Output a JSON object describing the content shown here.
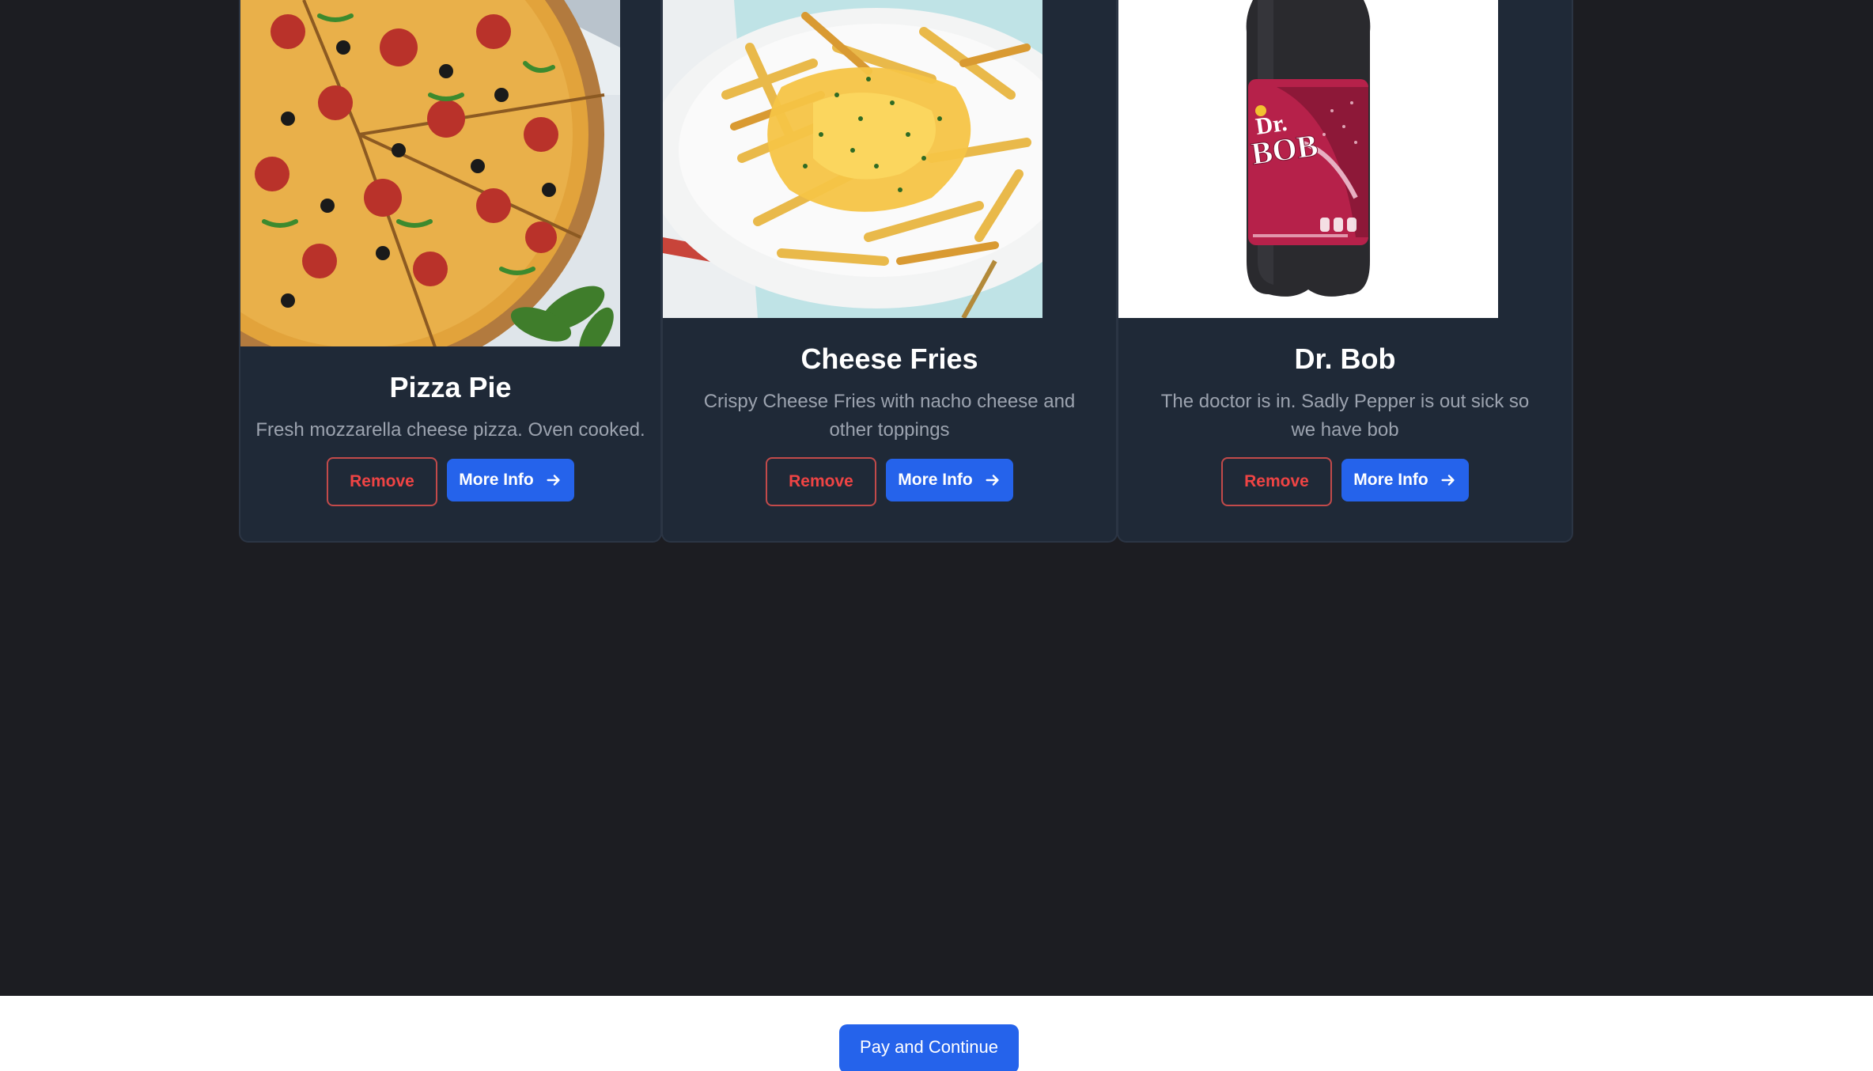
{
  "products": [
    {
      "title": "Pizza Pie",
      "description": "Fresh mozzarella cheese pizza. Oven cooked.",
      "image": "pizza-photo",
      "remove_label": "Remove",
      "info_label": "More Info"
    },
    {
      "title": "Cheese Fries",
      "description": "Crispy Cheese Fries with nacho cheese and other toppings",
      "image": "cheese-fries-photo",
      "remove_label": "Remove",
      "info_label": "More Info"
    },
    {
      "title": "Dr. Bob",
      "description": "The doctor is in. Sadly Pepper is out sick so we have bob",
      "image": "soda-bottle-photo",
      "remove_label": "Remove",
      "info_label": "More Info"
    }
  ],
  "footer": {
    "pay_label": "Pay and Continue"
  },
  "colors": {
    "background": "#1c1d22",
    "card": "#1f2937",
    "primary": "#2563eb",
    "danger": "#ef4444"
  }
}
